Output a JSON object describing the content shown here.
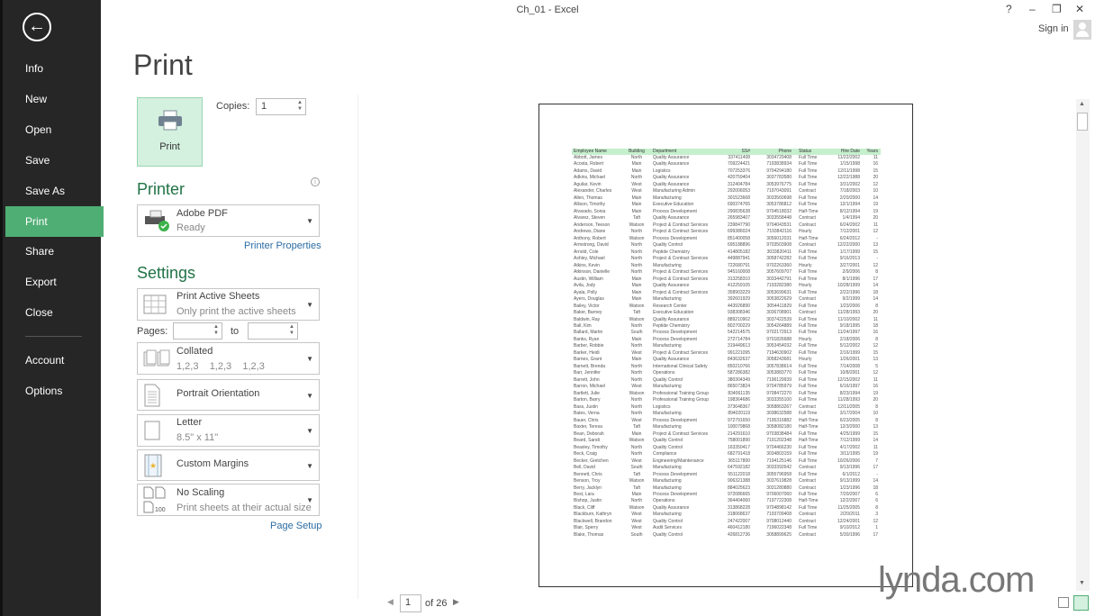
{
  "window": {
    "title": "Ch_01 - Excel",
    "help": "?",
    "minimize": "–",
    "restore": "❐",
    "close": "✕",
    "sign_in": "Sign in"
  },
  "sidebar": {
    "back": "←",
    "items": [
      {
        "label": "Info"
      },
      {
        "label": "New"
      },
      {
        "label": "Open"
      },
      {
        "label": "Save"
      },
      {
        "label": "Save As"
      },
      {
        "label": "Print",
        "active": true
      },
      {
        "label": "Share"
      },
      {
        "label": "Export"
      },
      {
        "label": "Close"
      },
      {
        "label": "Account"
      },
      {
        "label": "Options"
      }
    ]
  },
  "print": {
    "title": "Print",
    "button": "Print",
    "copies_label": "Copies:",
    "copies": "1"
  },
  "printer": {
    "heading": "Printer",
    "name": "Adobe PDF",
    "status": "Ready",
    "properties": "Printer Properties"
  },
  "settings": {
    "heading": "Settings",
    "sheets": {
      "title": "Print Active Sheets",
      "sub": "Only print the active sheets"
    },
    "pages_label": "Pages:",
    "to_label": "to",
    "pages_from": "",
    "pages_to": "",
    "collation": {
      "title": "Collated",
      "sub": "1,2,3    1,2,3    1,2,3"
    },
    "orientation": {
      "title": "Portrait Orientation"
    },
    "paper": {
      "title": "Letter",
      "sub": "8.5\" x 11\""
    },
    "margins": {
      "title": "Custom Margins"
    },
    "scaling": {
      "title": "No Scaling",
      "sub": "Print sheets at their actual size"
    },
    "page_setup": "Page Setup"
  },
  "preview": {
    "current_page": "1",
    "of_label": "of 26",
    "headers": [
      "Employee Name",
      "Building",
      "Department",
      "SS#",
      "Phone",
      "Status",
      "Hire Date",
      "Years"
    ],
    "rows": [
      [
        "Abbott, James",
        "North",
        "Quality Assurance",
        "337411408",
        "3034729408",
        "Full Time",
        "11/22/2002",
        "11"
      ],
      [
        "Acosta, Robert",
        "Main",
        "Quality Assurance",
        "709224421",
        "7193838934",
        "Full Time",
        "1/15/1998",
        "16"
      ],
      [
        "Adams, David",
        "Main",
        "Logistics",
        "707253376",
        "9704294180",
        "Full Time",
        "12/11/1998",
        "15"
      ],
      [
        "Adkins, Michael",
        "North",
        "Quality Assurance",
        "420759404",
        "3037783580",
        "Full Time",
        "12/22/1988",
        "20"
      ],
      [
        "Aguilar, Kevin",
        "West",
        "Quality Assurance",
        "312404784",
        "3053976775",
        "Full Time",
        "3/31/2002",
        "12"
      ],
      [
        "Alexander, Charles",
        "West",
        "Manufacturing Admin",
        "292006053",
        "7197043091",
        "Contract",
        "7/18/2003",
        "10"
      ],
      [
        "Allen, Thomas",
        "Main",
        "Manufacturing",
        "301523668",
        "3033560698",
        "Full Time",
        "2/20/2000",
        "14"
      ],
      [
        "Allison, Timothy",
        "Main",
        "Executive Education",
        "690374765",
        "3053786812",
        "Full Time",
        "12/1/1994",
        "19"
      ],
      [
        "Alvarado, Sonia",
        "Main",
        "Process Development",
        "290835638",
        "9704518032",
        "Half-Time",
        "8/12/1994",
        "19"
      ],
      [
        "Alvarez, Steven",
        "Taft",
        "Quality Assurance",
        "265983407",
        "3033558448",
        "Contract",
        "1/4/1994",
        "20"
      ],
      [
        "Anderson, Teeson",
        "Watson",
        "Project & Contract Services",
        "239847790",
        "9704043531",
        "Contract",
        "6/24/2002",
        "11"
      ],
      [
        "Andrews, Diane",
        "North",
        "Project & Contract Services",
        "699386024",
        "7193842116",
        "Hourly",
        "7/12/2001",
        "12"
      ],
      [
        "Anthony, Robert",
        "Watson",
        "Process Development",
        "851400058",
        "3056012031",
        "Half-Time",
        "6/24/2012",
        "-"
      ],
      [
        "Armstrong, David",
        "North",
        "Quality Control",
        "695188896",
        "9703503908",
        "Contract",
        "12/22/2000",
        "13"
      ],
      [
        "Arnold, Cole",
        "North",
        "Peptide Chemistry",
        "414805182",
        "3033820411",
        "Full Time",
        "1/17/1999",
        "15"
      ],
      [
        "Ashley, Michael",
        "North",
        "Project & Contract Services",
        "449887941",
        "3058742282",
        "Full Time",
        "9/16/2013",
        "-"
      ],
      [
        "Atkins, Kevin",
        "North",
        "Manufacturing",
        "722680791",
        "9702263360",
        "Hourly",
        "3/27/2001",
        "12"
      ],
      [
        "Atkinson, Danielle",
        "North",
        "Project & Contract Services",
        "945160008",
        "3057609707",
        "Full Time",
        "2/9/2006",
        "8"
      ],
      [
        "Austin, William",
        "Main",
        "Project & Contract Services",
        "313258310",
        "3033442791",
        "Full Time",
        "8/1/1996",
        "17"
      ],
      [
        "Avila, Jody",
        "Main",
        "Quality Assurance",
        "412259105",
        "7193282380",
        "Hourly",
        "10/28/1999",
        "14"
      ],
      [
        "Ayala, Polly",
        "Main",
        "Project & Contract Services",
        "358903229",
        "3053699631",
        "Full Time",
        "2/22/1996",
        "18"
      ],
      [
        "Ayers, Douglas",
        "Main",
        "Manufacturing",
        "392601929",
        "3053822629",
        "Contract",
        "9/2/1999",
        "14"
      ],
      [
        "Bailey, Victor",
        "Watson",
        "Research Center",
        "443926890",
        "3054411829",
        "Full Time",
        "1/23/2006",
        "8"
      ],
      [
        "Baker, Barney",
        "Taft",
        "Executive Education",
        "938308346",
        "3036708901",
        "Contract",
        "11/28/1993",
        "20"
      ],
      [
        "Baldwin, Ray",
        "Watson",
        "Quality Assurance",
        "889210902",
        "3037422539",
        "Full Time",
        "11/10/2002",
        "11"
      ],
      [
        "Ball, Kim",
        "North",
        "Peptide Chemistry",
        "802700229",
        "3054264889",
        "Full Time",
        "9/18/1995",
        "18"
      ],
      [
        "Ballard, Martin",
        "South",
        "Process Development",
        "542214575",
        "9702172913",
        "Full Time",
        "11/24/1997",
        "16"
      ],
      [
        "Banks, Ryan",
        "Main",
        "Process Development",
        "272714784",
        "9701826688",
        "Hourly",
        "2/18/2006",
        "8"
      ],
      [
        "Barber, Robbie",
        "North",
        "Manufacturing",
        "319449613",
        "3053454032",
        "Full Time",
        "5/12/2002",
        "12"
      ],
      [
        "Barker, Heidi",
        "West",
        "Project & Contract Services",
        "991221095",
        "7194630902",
        "Full Time",
        "2/16/1999",
        "15"
      ],
      [
        "Barnes, Grant",
        "Main",
        "Quality Assurance",
        "843632637",
        "3058243681",
        "Hourly",
        "1/26/2001",
        "13"
      ],
      [
        "Barnett, Brenda",
        "North",
        "International Clinical Safety",
        "850210766",
        "3057838614",
        "Full Time",
        "7/14/2008",
        "5"
      ],
      [
        "Barr, Jennifer",
        "North",
        "Operations",
        "587286382",
        "3053883770",
        "Full Time",
        "10/8/2001",
        "12"
      ],
      [
        "Barrett, John",
        "North",
        "Quality Control",
        "380304349",
        "7196129939",
        "Full Time",
        "12/15/2002",
        "11"
      ],
      [
        "Barron, Michael",
        "West",
        "Manufacturing",
        "865073824",
        "9704785979",
        "Full Time",
        "6/16/1997",
        "16"
      ],
      [
        "Bartlett, Julie",
        "Watson",
        "Professional Training Group",
        "834061135",
        "9708472270",
        "Full Time",
        "8/23/1994",
        "19"
      ],
      [
        "Barton, Barry",
        "North",
        "Professional Training Group",
        "198364686",
        "3033355100",
        "Full Time",
        "11/28/1993",
        "20"
      ],
      [
        "Bass, Justin",
        "North",
        "Logistics",
        "373648367",
        "3058863267",
        "Contract",
        "12/11/2005",
        "8"
      ],
      [
        "Bates, Verna",
        "North",
        "Manufacturing",
        "894020119",
        "3038632588",
        "Full Time",
        "3/17/2004",
        "10"
      ],
      [
        "Bauer, Chris",
        "West",
        "Process Development",
        "972791650",
        "7195316882",
        "Half-Time",
        "6/23/2005",
        "8"
      ],
      [
        "Baxter, Teresa",
        "Taft",
        "Manufacturing",
        "100079868",
        "3058082180",
        "Half-Time",
        "12/3/2000",
        "13"
      ],
      [
        "Bean, Deborah",
        "Main",
        "Project & Contract Services",
        "214291610",
        "9703838484",
        "Full Time",
        "4/25/1999",
        "15"
      ],
      [
        "Beard, Sandi",
        "Watson",
        "Quality Control",
        "758001890",
        "7191202348",
        "Half-Time",
        "7/12/1999",
        "14"
      ],
      [
        "Beasley, Timothy",
        "North",
        "Quality Control",
        "163350417",
        "9704466230",
        "Full Time",
        "4/17/2002",
        "11"
      ],
      [
        "Beck, Craig",
        "North",
        "Compliance",
        "682791418",
        "3034803159",
        "Full Time",
        "3/11/1995",
        "19"
      ],
      [
        "Becker, Gretchen",
        "West",
        "Engineering/Maintenance",
        "365117800",
        "7194125146",
        "Full Time",
        "10/26/2006",
        "7"
      ],
      [
        "Bell, David",
        "South",
        "Manufacturing",
        "647592182",
        "3033392642",
        "Contract",
        "9/13/1996",
        "17"
      ],
      [
        "Bennett, Chris",
        "Taft",
        "Process Development",
        "551122018",
        "3055796958",
        "Full Time",
        "6/1/2012",
        "-"
      ],
      [
        "Benson, Troy",
        "Watson",
        "Manufacturing",
        "906321388",
        "3037619828",
        "Contract",
        "9/13/1999",
        "14"
      ],
      [
        "Berry, Jacklyn",
        "Taft",
        "Manufacturing",
        "884025623",
        "3031280880",
        "Contract",
        "1/23/1996",
        "18"
      ],
      [
        "Best, Lara",
        "Main",
        "Process Development",
        "972086665",
        "9706007060",
        "Full Time",
        "7/20/2007",
        "6"
      ],
      [
        "Bishop, Justin",
        "North",
        "Operations",
        "364404060",
        "7197722308",
        "Half-Time",
        "12/2/2007",
        "6"
      ],
      [
        "Black, Cliff",
        "Watson",
        "Quality Assurance",
        "313868228",
        "9704898142",
        "Full Time",
        "11/25/2005",
        "8"
      ],
      [
        "Blackburn, Kathryn",
        "West",
        "Manufacturing",
        "318068637",
        "7193709408",
        "Contract",
        "2/20/2011",
        "3"
      ],
      [
        "Blackwell, Brandon",
        "West",
        "Quality Control",
        "247422007",
        "9708012440",
        "Contract",
        "12/24/2001",
        "12"
      ],
      [
        "Blair, Sperry",
        "West",
        "Audit Services",
        "460412180",
        "7196022348",
        "Full Time",
        "9/10/2012",
        "1"
      ],
      [
        "Blake, Thomas",
        "South",
        "Quality Control",
        "426812736",
        "3058899625",
        "Contract",
        "5/30/1996",
        "17"
      ]
    ]
  },
  "watermark": "lynda.com",
  "colors": {
    "sidebar": "#262626",
    "accent": "#217346",
    "active_nav": "#4fae74",
    "print_button": "#d4f0df",
    "header_row": "#c6efce"
  }
}
